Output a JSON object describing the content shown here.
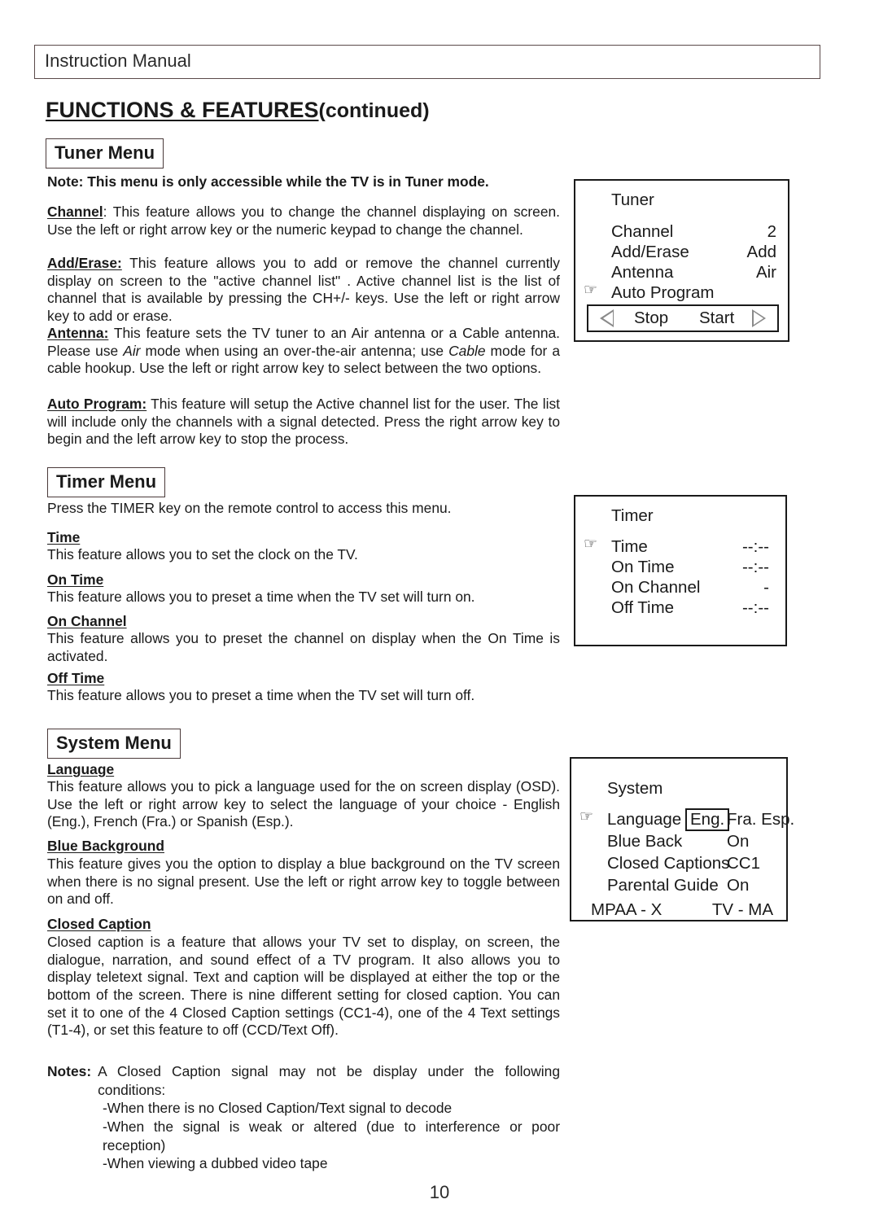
{
  "header": {
    "title": "Instruction Manual"
  },
  "page_title": {
    "main": "FUNCTIONS & FEATURES",
    "suffix": "(continued)"
  },
  "page_number": "10",
  "sections": {
    "tuner": {
      "heading": "Tuner Menu",
      "note": "Note: This menu is only accessible while the TV is in Tuner mode.",
      "paragraphs": [
        {
          "lead": "Channel",
          "lead_tail": ":",
          "body": " This feature allows you to change the channel displaying on screen. Use the left or right arrow key or the numeric keypad to change the channel."
        },
        {
          "lead": "Add/Erase:",
          "lead_tail": "",
          "body": " This feature allows you to add or remove the channel currently display on screen to the \"active channel list\" . Active channel list is the list of channel that is available by pressing the CH+/- keys.  Use the left or right arrow key to add or erase."
        },
        {
          "lead": "Antenna:",
          "lead_tail": "",
          "body_1": " This feature sets the TV tuner to an Air antenna or a Cable antenna. Please use ",
          "italic_1": "Air",
          "body_2": " mode when using an over-the-air antenna; use ",
          "italic_2": "Cable",
          "body_3": " mode for a cable hookup. Use the left or right arrow key to select between the two options."
        },
        {
          "lead": "Auto Program:",
          "lead_tail": "",
          "body": " This feature will setup the Active channel list for the user. The list will include only the channels with a signal detected.  Press the right arrow key to begin and the left arrow key to stop the process."
        }
      ]
    },
    "timer": {
      "heading": "Timer Menu",
      "intro": "Press the TIMER key on the remote control to access this menu.",
      "items": [
        {
          "head": "Time",
          "body": "This feature allows you to set the clock on the TV."
        },
        {
          "head": "On Time",
          "body": "This feature allows you to preset a time when the TV set will turn on."
        },
        {
          "head": "On Channel",
          "body": "This feature allows you to preset the channel on display when the On Time is activated."
        },
        {
          "head": "Off Time",
          "body": "This feature allows you to preset a time when the TV set will turn off."
        }
      ]
    },
    "system": {
      "heading": "System Menu",
      "items": [
        {
          "head": "Language",
          "body": "This feature allows you to pick a language used for the on screen display (OSD).  Use the left or right arrow key to select the language of your choice - English (Eng.), French (Fra.) or Spanish (Esp.)."
        },
        {
          "head": "Blue Background",
          "body": "This feature gives you the option to display a blue background on the TV screen when there is no signal present.  Use the left or right arrow key to toggle between on and off."
        },
        {
          "head": "Closed Caption",
          "body": "Closed caption is a feature that allows your TV set to display, on screen, the dialogue, narration, and sound effect of a TV program.  It also allows you to display teletext signal.  Text and caption will be displayed at either the top or the bottom of the screen.  There is nine different setting for closed caption.  You can set it to one of the 4 Closed Caption settings (CC1-4), one of the 4 Text settings (T1-4), or set this feature to off (CCD/Text Off)."
        }
      ],
      "notes": {
        "label": "Notes:",
        "intro": "A Closed Caption signal may not be display under the following conditions:",
        "bullets": [
          "-When there is no Closed Caption/Text signal to decode",
          "-When the signal is weak or altered (due to interference or poor reception)",
          "-When viewing a dubbed video tape"
        ]
      }
    }
  },
  "osd_panels": {
    "tuner": {
      "title": "Tuner",
      "rows": [
        {
          "pointer": "",
          "label": "Channel",
          "value": "2"
        },
        {
          "pointer": "",
          "label": "Add/Erase",
          "value": "Add"
        },
        {
          "pointer": "",
          "label": "Antenna",
          "value": "Air"
        },
        {
          "pointer": "☞",
          "label": "Auto Program",
          "value": ""
        }
      ],
      "arrow_bar": {
        "left_arrow": "left-triangle",
        "stop_label": "Stop",
        "start_label": "Start",
        "right_arrow": "right-triangle"
      }
    },
    "timer": {
      "title": "Timer",
      "rows": [
        {
          "pointer": "☞",
          "label": "Time",
          "value": "--:--"
        },
        {
          "pointer": "",
          "label": "On Time",
          "value": "--:--"
        },
        {
          "pointer": "",
          "label": "On Channel",
          "value": "-"
        },
        {
          "pointer": "",
          "label": "Off Time",
          "value": "--:--"
        }
      ]
    },
    "system": {
      "title": "System",
      "rows": [
        {
          "pointer": "☞",
          "label": "Language",
          "chip": "Eng.",
          "value": "Fra. Esp."
        },
        {
          "pointer": "",
          "label": "Blue Back",
          "chip": "",
          "value": "On"
        },
        {
          "pointer": "",
          "label": "Closed Captions",
          "chip": "",
          "value": "CC1"
        },
        {
          "pointer": "",
          "label": "Parental Guide",
          "chip": "",
          "value": "On"
        }
      ],
      "mpaa_rating": "MPAA - X",
      "tv_rating": "TV - MA"
    }
  },
  "colors": {
    "ink": "#1a1a1a",
    "header_border": "#5a4a4a",
    "arrow_gray": "#8a8a8a",
    "page_bg": "#ffffff"
  }
}
